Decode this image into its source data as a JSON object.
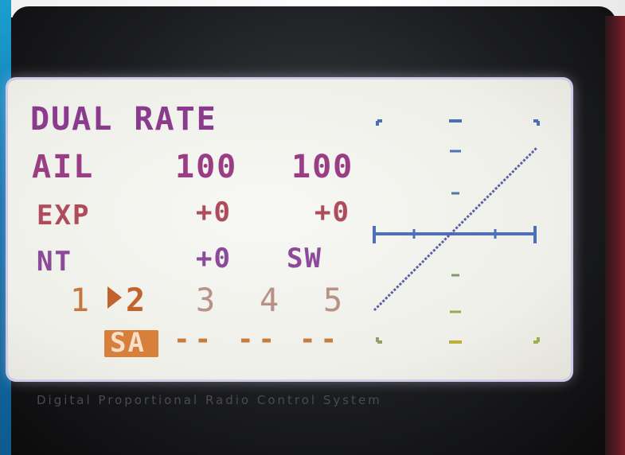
{
  "screen": {
    "title": "DUAL RATE",
    "channel": "AIL",
    "rate_left": "100",
    "rate_right": "100",
    "exp_label": "EXP",
    "exp_left": "+0",
    "exp_right": "+0",
    "nt_label": "NT",
    "nt_left": "+0",
    "nt_right": "SW",
    "slot_1": "1",
    "slot_2": "2",
    "slot_3": "3",
    "slot_4": "4",
    "slot_5": "5",
    "selected_slot": "2",
    "switch_assign": "SA",
    "switch_2": "--",
    "switch_3": "--",
    "switch_4": "--"
  },
  "graph": {
    "rate_percent": 100,
    "expo": 0,
    "colors": {
      "horizontal_axis": "#4f6fb8",
      "vertical_axis_top": "#4a6fb2",
      "vertical_axis_bottom": "#b8b13d",
      "curve": "#5a5fa8",
      "corner_top": "#4a6fb2",
      "corner_bottom": "#9bb048"
    }
  },
  "footer": {
    "text": "Digital Proportional Radio Control System"
  },
  "colors": {
    "title": "#8a3b8e",
    "exp": "#b04b5c",
    "nt": "#8c4a9a",
    "slots": "#c9743b",
    "lcd_bg": "#f2f2ee"
  }
}
